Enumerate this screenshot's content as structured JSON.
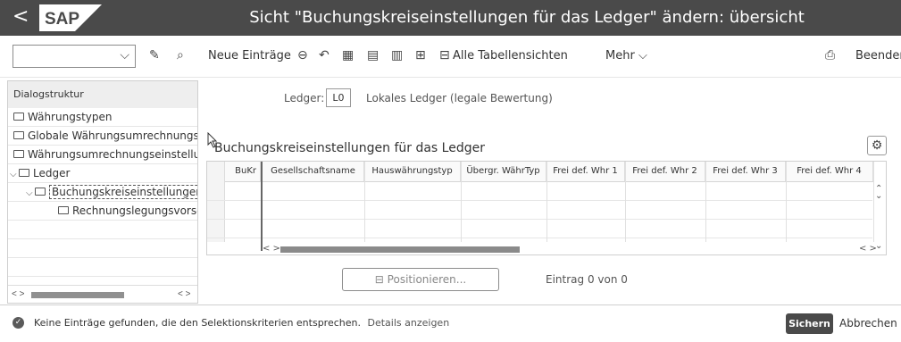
{
  "window": {
    "title": "Sicht \"Buchungskreiseinstellungen für das Ledger\" ändern: übersicht",
    "back_glyph": "<",
    "logo_text": "SAP"
  },
  "toolbar": {
    "select_value": "",
    "neue_eintraege": "Neue Einträge",
    "alle_tabellensichten": "Alle Tabellensichten",
    "mehr": "Mehr",
    "beenden": "Beenden"
  },
  "dialog_structure": {
    "header": "Dialogstruktur",
    "items": [
      {
        "label": "Währungstypen",
        "level": 0
      },
      {
        "label": "Globale Währungsumrechnungse",
        "level": 0
      },
      {
        "label": "Währungsumrechnungseinstellun",
        "level": 0
      },
      {
        "label": "Ledger",
        "level": 0,
        "expanded": true
      },
      {
        "label": "Buchungskreiseinstellungen fü",
        "level": 1,
        "expanded": true,
        "selected": true
      },
      {
        "label": "Rechnungslegungsvorschrif",
        "level": 2
      }
    ]
  },
  "ledger": {
    "label": "Ledger:",
    "value": "L0",
    "description": "Lokales Ledger (legale Bewertung)"
  },
  "section": {
    "title": "Buchungskreiseinstellungen für das Ledger"
  },
  "table": {
    "columns": [
      "BuKr",
      "Gesellschaftsname",
      "Hauswährungstyp",
      "Übergr. WährTyp",
      "Frei def. Whr 1",
      "Frei def. Whr 2",
      "Frei def. Whr 3",
      "Frei def. Whr 4"
    ],
    "rows": []
  },
  "positioning": {
    "button_label": "Positionieren...",
    "entry_text": "Eintrag 0 von 0"
  },
  "status": {
    "message": "Keine Einträge gefunden, die den Selektionskriterien entsprechen.",
    "details_link": "Details anzeigen",
    "save_button": "Sichern",
    "cancel_button": "Abbrechen"
  },
  "colors": {
    "titlebar": "#4a4a4a",
    "primary_button": "#4a4a4a",
    "scrollbar_thumb": "#8a8a8a"
  }
}
